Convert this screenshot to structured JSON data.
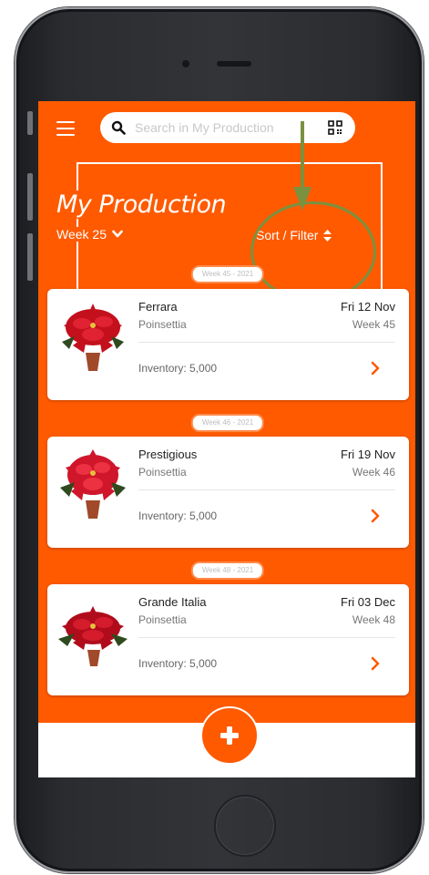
{
  "app": {
    "search": {
      "placeholder": "Search in My Production"
    },
    "title": "My Production",
    "week_selector": "Week 25",
    "sort_filter": "Sort / Filter",
    "accent_color": "#ff5a00",
    "annotation_color": "#7a9140"
  },
  "productions": [
    {
      "week_badge": "Week 45 - 2021",
      "name": "Ferrara",
      "type": "Poinsettia",
      "date": "Fri 12 Nov",
      "week": "Week 45",
      "inventory": "Inventory: 5,000"
    },
    {
      "week_badge": "Week 46 - 2021",
      "name": "Prestigious",
      "type": "Poinsettia",
      "date": "Fri 19 Nov",
      "week": "Week 46",
      "inventory": "Inventory: 5,000"
    },
    {
      "week_badge": "Week 48 - 2021",
      "name": "Grande Italia",
      "type": "Poinsettia",
      "date": "Fri 03 Dec",
      "week": "Week 48",
      "inventory": "Inventory: 5,000"
    }
  ],
  "icons": {
    "menu": "hamburger-icon",
    "search": "search-icon",
    "qr": "qr-code-icon",
    "week_chevron": "chevron-down-icon",
    "sort": "sort-arrows-icon",
    "row_chevron": "chevron-right-icon",
    "add": "plus-icon"
  }
}
